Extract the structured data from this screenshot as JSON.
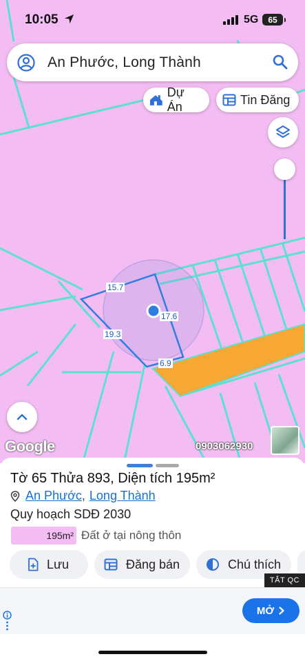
{
  "status_bar": {
    "time": "10:05",
    "network": "5G",
    "battery": "65"
  },
  "search": {
    "query": "An Phước, Long Thành"
  },
  "chips": {
    "du_an": "Dự Án",
    "tin_dang": "Tin Đăng"
  },
  "map": {
    "dimensions": {
      "top": "15.7",
      "right": "17.6",
      "left": "19.3",
      "bottom": "6.9"
    },
    "attribution": "Google",
    "watermark_phone": "0903062930",
    "colors": {
      "base": "#f3bdf3",
      "lines": "#5ee0d0",
      "highlight": "#f7a733",
      "parcel": "#2f7de1"
    }
  },
  "sheet": {
    "title": "Tờ 65 Thửa 893, Diện tích 195m²",
    "location_ward": "An Phước",
    "location_sep": ",",
    "location_district": "Long Thành",
    "plan_title": "Quy hoạch SDĐ 2030",
    "legend_area": "195m²",
    "legend_label": "Đất ở tại nông thôn",
    "actions": {
      "save": "Lưu",
      "post": "Đăng bán",
      "legend": "Chú thích"
    }
  },
  "ad": {
    "close_label": "TẮT QC",
    "cta": "MỞ"
  }
}
